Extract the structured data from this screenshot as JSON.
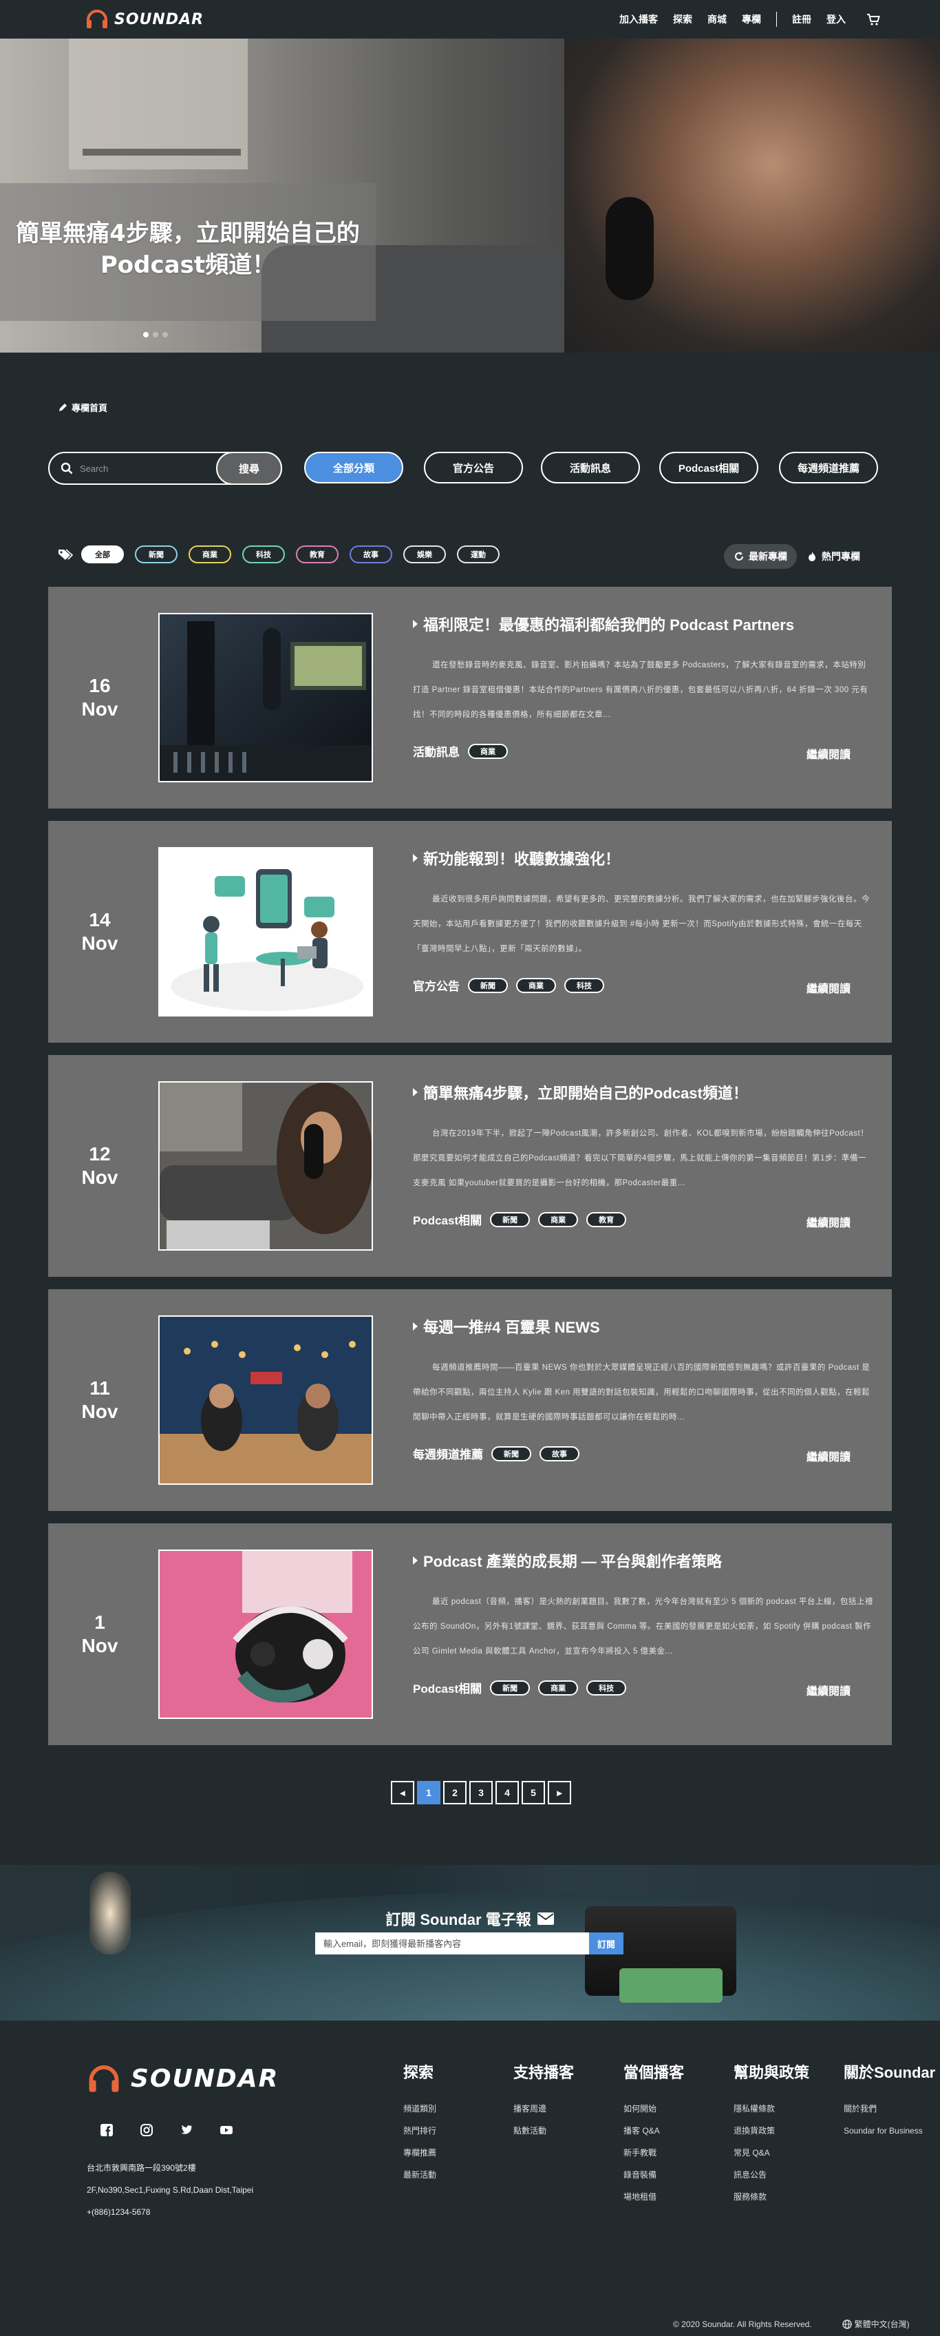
{
  "nav": {
    "brand": "SOUNDAR",
    "links": [
      "加入播客",
      "探索",
      "商城",
      "專欄"
    ],
    "signup": "註冊",
    "login": "登入"
  },
  "hero": {
    "title": "簡單無痛4步驟，立即開始自己的Podcast頻道！",
    "dots": 3,
    "active_dot": 0
  },
  "breadcrumb": "專欄首頁",
  "search": {
    "placeholder": "Search",
    "button": "搜尋"
  },
  "categories": [
    "全部分類",
    "官方公告",
    "活動訊息",
    "Podcast相關",
    "每週頻道推薦"
  ],
  "active_category": 0,
  "tags": [
    {
      "label": "全部",
      "color": "#ffffff"
    },
    {
      "label": "新聞",
      "color": "#8fd3e8"
    },
    {
      "label": "商業",
      "color": "#e8d35a"
    },
    {
      "label": "科技",
      "color": "#6fd9b3"
    },
    {
      "label": "教育",
      "color": "#e07fb5"
    },
    {
      "label": "故事",
      "color": "#6b7fe0"
    },
    {
      "label": "娛樂",
      "color": "#e6e6e6"
    },
    {
      "label": "運動",
      "color": "#e6e6e6"
    }
  ],
  "sort": {
    "latest": "最新專欄",
    "hot": "熱門專欄"
  },
  "posts": [
    {
      "day": "16",
      "month": "Nov",
      "title": "福利限定！最優惠的福利都給我們的 Podcast Partners",
      "excerpt": "還在發愁錄音時的麥克風、錄音室、影片拍攝嗎？本站為了鼓勵更多 Podcasters，了解大家有錄音室的需求，本站特別打造 Partner 錄音室租借優惠！本站合作的Partners 有厲價再八折的優惠，包套最低可以八折再八折，64 折錄一次 300 元有找！不同的時段的各種優惠價格，所有細節都在文章...",
      "category": "活動訊息",
      "tags": [
        "商業"
      ],
      "read_more": "繼續閱讀",
      "image": "studio"
    },
    {
      "day": "14",
      "month": "Nov",
      "title": "新功能報到！收聽數據強化！",
      "excerpt": "最近收到很多用戶詢問數據問題，希望有更多的、更完整的數據分析。我們了解大家的需求，也在加緊腳步強化後台。今天開始，本站用戶看數據更方便了！我們的收聽數據升級到 #每小時 更新一次！而Spotify由於數據形式特殊，會統一在每天「臺灣時間早上八點」，更新「兩天前的數據」。",
      "category": "官方公告",
      "tags": [
        "新聞",
        "商業",
        "科技"
      ],
      "read_more": "繼續閱讀",
      "image": "illustration"
    },
    {
      "day": "12",
      "month": "Nov",
      "title": "簡單無痛4步驟，立即開始自己的Podcast頻道！",
      "excerpt": "台灣在2019年下半，掀起了一陣Podcast風潮，許多新創公司、創作者、KOL都嗅到新市場，紛紛踏觸角伸往Podcast！那麼究竟要如何才能成立自己的Podcast頻道？看完以下簡單的4個步驟，馬上就能上傳你的第一集音頻節目！第1步：準備一支麥克風 如果youtuber就要買的是攝影一台好的相機，那Podcaster最重...",
      "category": "Podcast相關",
      "tags": [
        "新聞",
        "商業",
        "教育"
      ],
      "read_more": "繼續閱讀",
      "image": "podcaster"
    },
    {
      "day": "11",
      "month": "Nov",
      "title": "每週一推#4 百靈果 NEWS",
      "excerpt": "每週頻道推薦時間——百靈果 NEWS 你也對於大眾媒體呈現正經八百的國際新聞感到無趣嗎？或許百靈果的 Podcast 是帶給你不同觀點，兩位主持人 Kylie 跟 Ken 用雙語的對話包裝知識，用輕鬆的口吻聊國際時事，從出不同的個人觀點，在輕鬆閒聊中帶入正經時事，就算是生硬的國際時事話題都可以讓你在輕鬆的時...",
      "category": "每週頻道推薦",
      "tags": [
        "新聞",
        "故事"
      ],
      "read_more": "繼續閱讀",
      "image": "onair"
    },
    {
      "day": "1",
      "month": "Nov",
      "title": "Podcast 產業的成長期 — 平台與創作者策略",
      "excerpt": "最近 podcast（音頻，播客）是火熱的創業題目。我數了數，光今年台灣就有至少 5 個新的 podcast 平台上線，包括上禮公布的 SoundOn，另外有1號課堂、鏡界、荻耳意與 Comma 等。在美國的發展更是如火如荼，如 Spotify 併購 podcast 製作公司 Gimlet Media 與軟體工具 Anchor，並宣布今年將投入 5 億美金...",
      "category": "Podcast相關",
      "tags": [
        "新聞",
        "商業",
        "科技"
      ],
      "read_more": "繼續閱讀",
      "image": "headphones"
    }
  ],
  "pagination": {
    "pages": [
      "1",
      "2",
      "3",
      "4",
      "5"
    ],
    "active": 0,
    "prev": "◂",
    "next": "▸"
  },
  "newsletter": {
    "title": "訂閱 Soundar 電子報",
    "placeholder": "輸入email，即刻獲得最新播客內容",
    "button": "訂閱"
  },
  "footer": {
    "brand": "SOUNDAR",
    "address1": "台北市敦興南路一段390號2樓",
    "address2": "2F,No390,Sec1,Fuxing S.Rd,Daan Dist,Taipei",
    "phone": "+(886)1234-5678",
    "columns": [
      {
        "title": "探索",
        "links": [
          "頻道類別",
          "熱門排行",
          "專欄推薦",
          "最新活動"
        ]
      },
      {
        "title": "支持播客",
        "links": [
          "播客周邊",
          "點數活動"
        ]
      },
      {
        "title": "當個播客",
        "links": [
          "如何開始",
          "播客 Q&A",
          "新手教戰",
          "錄音裝備",
          "場地租借"
        ]
      },
      {
        "title": "幫助與政策",
        "links": [
          "隱私權條款",
          "退換貨政策",
          "常見 Q&A",
          "訊息公告",
          "服務條款"
        ]
      },
      {
        "title": "關於Soundar",
        "links": [
          "關於我們",
          "Soundar for Business"
        ]
      }
    ],
    "copyright": "© 2020 Soundar. All Rights Reserved.",
    "language": "繁體中文(台灣)"
  }
}
